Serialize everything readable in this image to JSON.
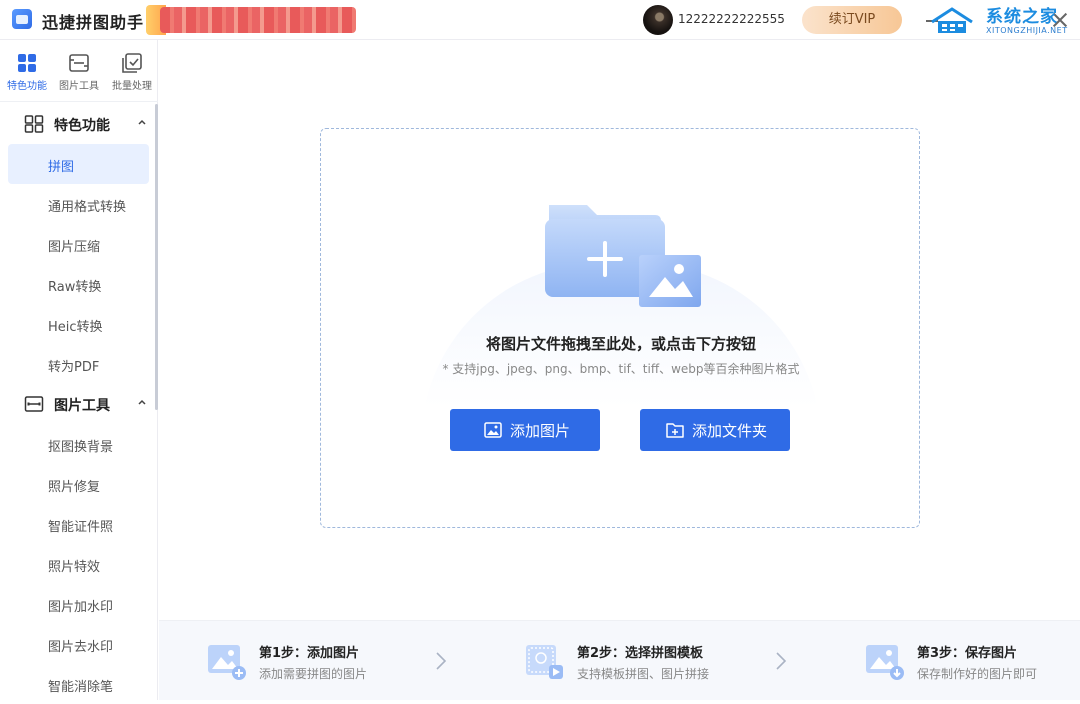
{
  "app": {
    "title": "迅捷拼图助手"
  },
  "header": {
    "user_id": "12222222222555",
    "vip_label": "续订VIP",
    "watermark": {
      "title": "系统之家",
      "subtitle": "XITONGZHIJIA.NET"
    }
  },
  "sidebar": {
    "tabs": [
      {
        "label": "特色功能",
        "icon": "grid-icon",
        "active": true
      },
      {
        "label": "图片工具",
        "icon": "image-tool-icon",
        "active": false
      },
      {
        "label": "批量处理",
        "icon": "batch-icon",
        "active": false
      }
    ],
    "sections": [
      {
        "title": "特色功能",
        "icon": "grid-icon",
        "expanded": true,
        "items": [
          "拼图",
          "通用格式转换",
          "图片压缩",
          "Raw转换",
          "Heic转换",
          "转为PDF"
        ]
      },
      {
        "title": "图片工具",
        "icon": "image-tool-icon",
        "expanded": true,
        "items": [
          "抠图换背景",
          "照片修复",
          "智能证件照",
          "照片特效",
          "图片加水印",
          "图片去水印",
          "智能消除笔"
        ]
      }
    ],
    "active_item": "拼图"
  },
  "dropzone": {
    "title": "将图片文件拖拽至此处，或点击下方按钮",
    "hint": "* 支持jpg、jpeg、png、bmp、tif、tiff、webp等百余种图片格式",
    "add_image_label": "添加图片",
    "add_folder_label": "添加文件夹"
  },
  "steps": [
    {
      "title": "第1步：添加图片",
      "desc": "添加需要拼图的图片"
    },
    {
      "title": "第2步：选择拼图模板",
      "desc": "支持模板拼图、图片拼接"
    },
    {
      "title": "第3步：保存图片",
      "desc": "保存制作好的图片即可"
    }
  ],
  "colors": {
    "accent": "#2f6be6",
    "active_bg": "#e8f0ff",
    "vip_bg": "#f7c796"
  }
}
